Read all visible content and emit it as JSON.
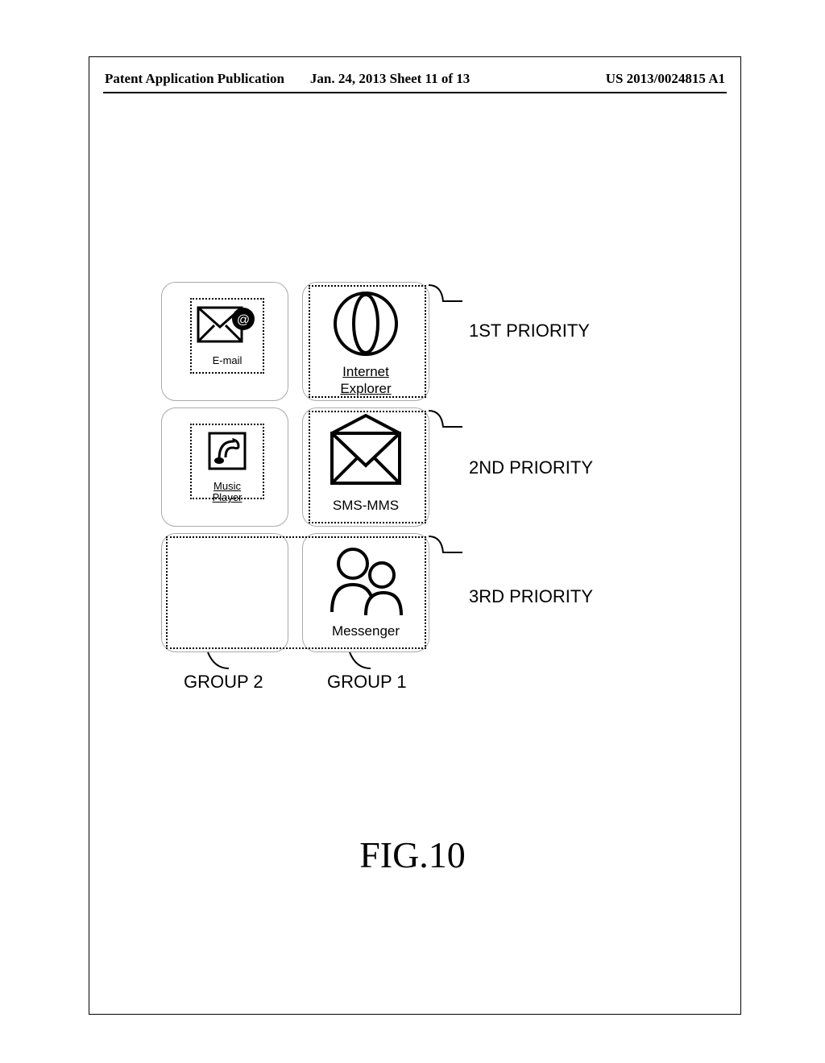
{
  "header": {
    "left": "Patent Application Publication",
    "mid": "Jan. 24, 2013  Sheet 11 of 13",
    "right": "US 2013/0024815 A1"
  },
  "cells": {
    "email_label": "E-mail",
    "ie_label_line1": "Internet",
    "ie_label_line2": "Explorer",
    "music_label": "Music Player",
    "sms_label": "SMS-MMS",
    "messenger_label": "Messenger"
  },
  "priorities": {
    "p1": "1ST PRIORITY",
    "p2": "2ND PRIORITY",
    "p3": "3RD PRIORITY"
  },
  "groups": {
    "g1": "GROUP 1",
    "g2": "GROUP 2"
  },
  "caption": "FIG.10"
}
